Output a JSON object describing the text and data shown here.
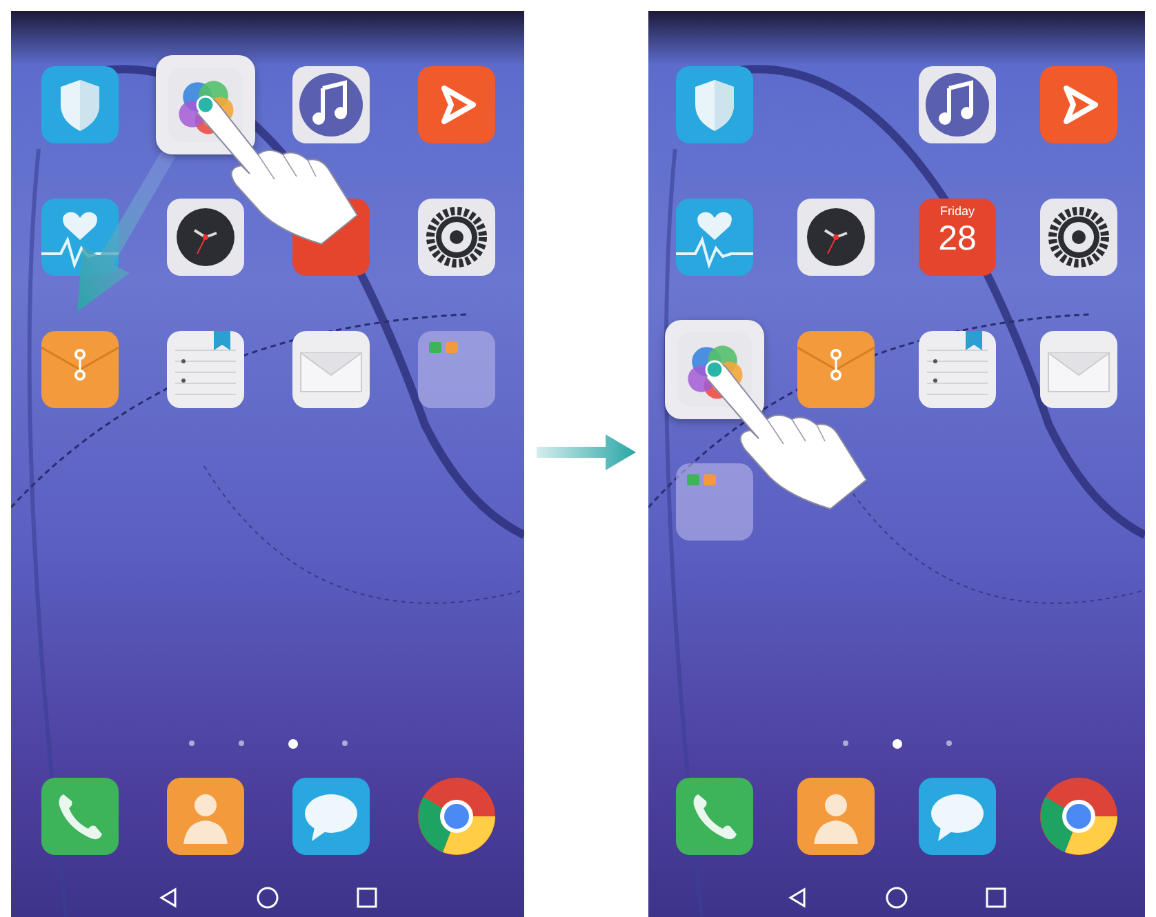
{
  "screens": [
    {
      "drag_arrow": true,
      "rows": [
        [
          {
            "kind": "security",
            "lifted": false
          },
          {
            "kind": "gallery",
            "lifted": true
          },
          {
            "kind": "music",
            "lifted": false
          },
          {
            "kind": "video",
            "lifted": false
          }
        ],
        [
          {
            "kind": "health",
            "lifted": false
          },
          {
            "kind": "clock",
            "lifted": false
          },
          {
            "kind": "calendar",
            "lifted": false
          },
          {
            "kind": "settings",
            "lifted": false
          }
        ],
        [
          {
            "kind": "files",
            "lifted": false
          },
          {
            "kind": "notes",
            "lifted": false
          },
          {
            "kind": "email",
            "lifted": false
          },
          {
            "kind": "folder",
            "lifted": false
          }
        ]
      ],
      "page_dots": [
        {
          "selected": false
        },
        {
          "selected": false
        },
        {
          "selected": true
        },
        {
          "selected": false
        }
      ],
      "dock": [
        {
          "kind": "phone"
        },
        {
          "kind": "contacts"
        },
        {
          "kind": "messages"
        },
        {
          "kind": "browser"
        }
      ]
    },
    {
      "drag_arrow": false,
      "rows": [
        [
          {
            "kind": "security",
            "lifted": false
          },
          {
            "kind": "empty"
          },
          {
            "kind": "music",
            "lifted": false
          },
          {
            "kind": "video",
            "lifted": false
          }
        ],
        [
          {
            "kind": "health",
            "lifted": false
          },
          {
            "kind": "clock",
            "lifted": false
          },
          {
            "kind": "calendar",
            "lifted": false,
            "weekday": "Friday",
            "day": "28"
          },
          {
            "kind": "settings",
            "lifted": false
          }
        ],
        [
          {
            "kind": "gallery",
            "lifted": true
          },
          {
            "kind": "files",
            "lifted": false
          },
          {
            "kind": "notes",
            "lifted": false
          },
          {
            "kind": "email",
            "lifted": false
          }
        ],
        [
          {
            "kind": "folder",
            "lifted": false
          },
          {
            "kind": "empty"
          },
          {
            "kind": "empty"
          },
          {
            "kind": "empty"
          }
        ]
      ],
      "page_dots": [
        {
          "selected": false
        },
        {
          "selected": true
        },
        {
          "selected": false
        }
      ],
      "dock": [
        {
          "kind": "phone"
        },
        {
          "kind": "contacts"
        },
        {
          "kind": "messages"
        },
        {
          "kind": "browser"
        }
      ]
    }
  ],
  "transition_arrow": true
}
